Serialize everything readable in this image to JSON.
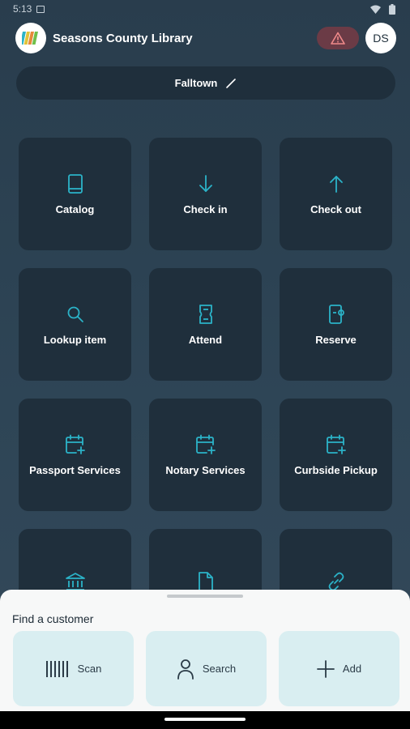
{
  "statusbar": {
    "time": "5:13"
  },
  "header": {
    "title": "Seasons County Library",
    "avatar_initials": "DS"
  },
  "branch": {
    "name": "Falltown"
  },
  "tiles": [
    {
      "label": "Catalog",
      "icon": "book-icon"
    },
    {
      "label": "Check in",
      "icon": "arrow-down-icon"
    },
    {
      "label": "Check out",
      "icon": "arrow-up-icon"
    },
    {
      "label": "Lookup item",
      "icon": "search-icon"
    },
    {
      "label": "Attend",
      "icon": "ticket-icon"
    },
    {
      "label": "Reserve",
      "icon": "reserve-door-icon"
    },
    {
      "label": "Passport Services",
      "icon": "calendar-add-icon"
    },
    {
      "label": "Notary Services",
      "icon": "calendar-add-icon"
    },
    {
      "label": "Curbside Pickup",
      "icon": "calendar-add-icon"
    },
    {
      "label": "",
      "icon": "bank-icon"
    },
    {
      "label": "",
      "icon": "document-icon"
    },
    {
      "label": "",
      "icon": "link-icon"
    }
  ],
  "customer_sheet": {
    "title": "Find a customer",
    "scan_label": "Scan",
    "search_label": "Search",
    "add_label": "Add"
  },
  "colors": {
    "accent": "#2bb3c8",
    "tile_bg": "#1f2f3c",
    "alert_bg": "#6b3b46",
    "sheet_button_bg": "#d9eef1"
  }
}
